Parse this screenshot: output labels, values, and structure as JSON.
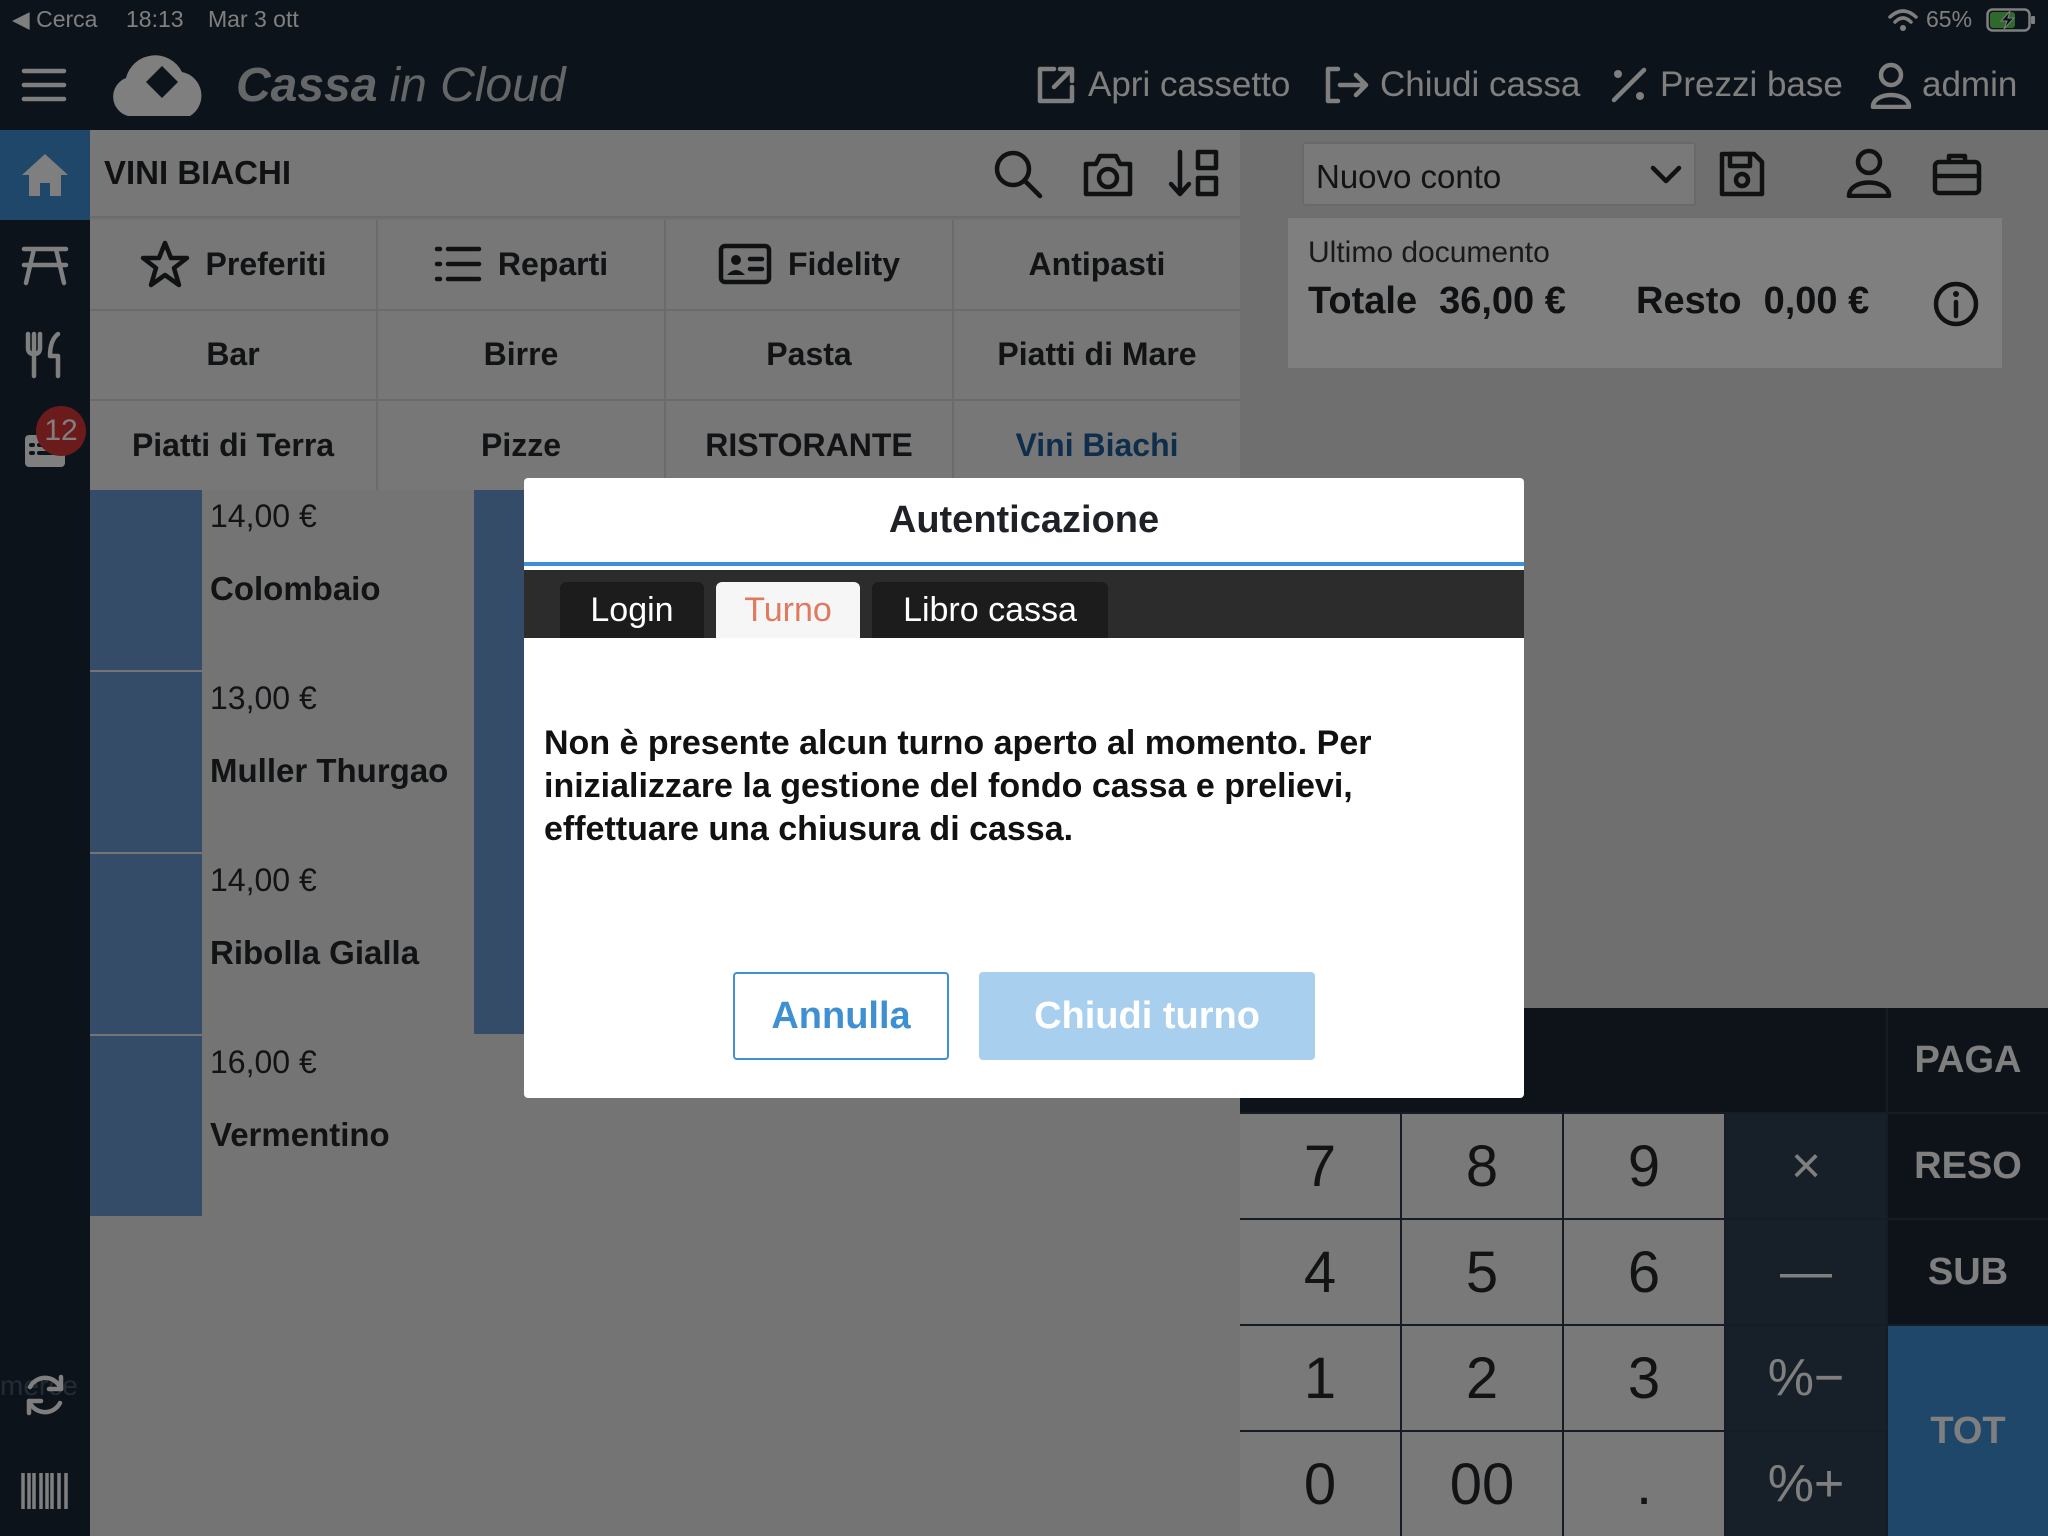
{
  "status_bar": {
    "back": "◀ Cerca",
    "time": "18:13",
    "date": "Mar 3 ott",
    "battery": "65%"
  },
  "header": {
    "brand_bold": "Cassa",
    "brand_light": "in Cloud",
    "actions": {
      "open_drawer": "Apri cassetto",
      "close_register": "Chiudi cassa",
      "base_prices": "Prezzi base",
      "user": "admin"
    }
  },
  "sidebar": {
    "badge": "12",
    "ghost_text": "merce"
  },
  "category_header": {
    "title": "VINI BIACHI"
  },
  "categories": [
    "Preferiti",
    "Reparti",
    "Fidelity",
    "Antipasti",
    "Bar",
    "Birre",
    "Pasta",
    "Piatti di Mare",
    "Piatti di Terra",
    "Pizze",
    "RISTORANTE",
    "Vini Biachi"
  ],
  "products": [
    {
      "price": "14,00 €",
      "name": "Colombaio"
    },
    {
      "price": "13,00 €",
      "name": "Muller Thurgao"
    },
    {
      "price": "14,00 €",
      "name": "Ribolla Gialla"
    },
    {
      "price": "16,00 €",
      "name": "Vermentino"
    }
  ],
  "account": {
    "selected": "Nuovo conto",
    "last_doc_label": "Ultimo documento",
    "total_label": "Totale",
    "total_value": "36,00 €",
    "change_label": "Resto",
    "change_value": "0,00 €"
  },
  "keypad": {
    "numbers": [
      "7",
      "8",
      "9",
      "4",
      "5",
      "6",
      "1",
      "2",
      "3",
      "0",
      "00",
      "."
    ],
    "operators": [
      "×",
      "—",
      "%−",
      "%+"
    ],
    "actions": [
      "PAGA",
      "RESO",
      "SUB",
      "TOT"
    ]
  },
  "dialog": {
    "title": "Autenticazione",
    "tabs": [
      "Login",
      "Turno",
      "Libro cassa"
    ],
    "active_tab": "Turno",
    "message": "Non è presente alcun turno aperto al momento. Per inizializzare la gestione del fondo cassa e prelievi, effettuare una chiusura di cassa.",
    "cancel_label": "Annulla",
    "confirm_label": "Chiudi turno"
  },
  "colors": {
    "navy": "#1b2734",
    "accent_blue": "#3f8fd3",
    "active_tab": "#e07a5f",
    "badge": "#d9373b",
    "product_stripe": "#6b99d3",
    "disabled_button": "#a9cfee"
  }
}
